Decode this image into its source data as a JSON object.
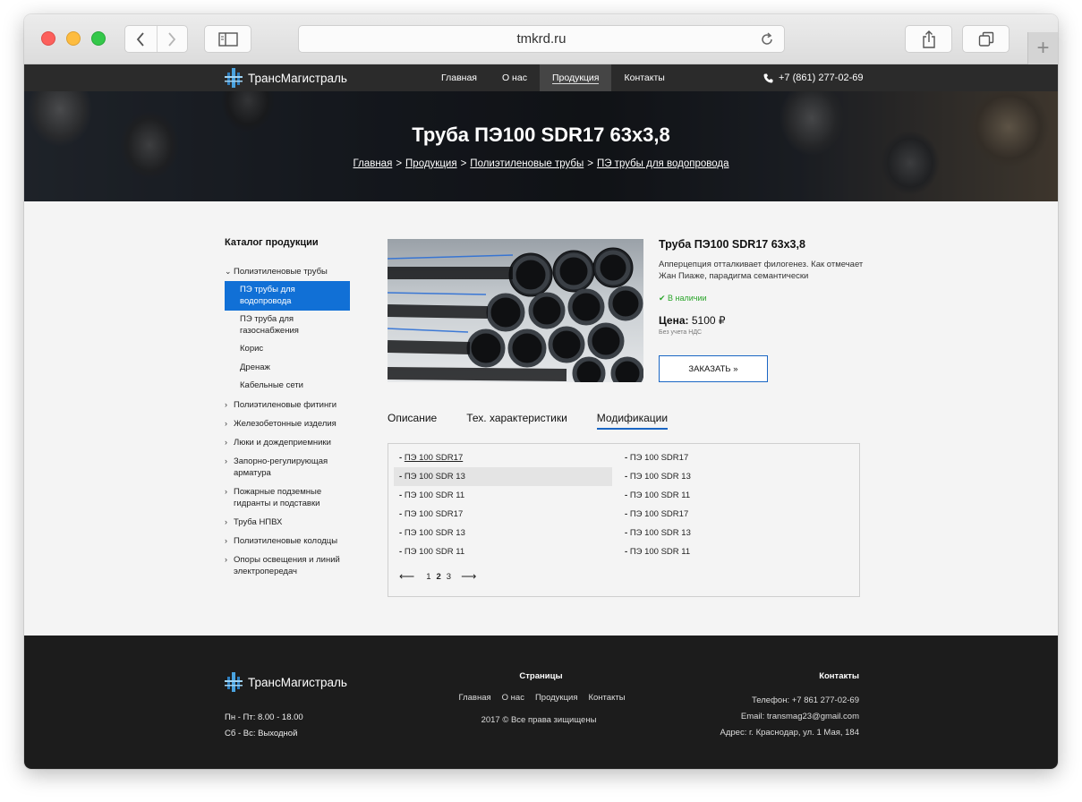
{
  "browser": {
    "url": "tmkrd.ru"
  },
  "header": {
    "logo_text": "ТрансМагистраль",
    "menu": [
      {
        "label": "Главная"
      },
      {
        "label": "О нас"
      },
      {
        "label": "Продукция"
      },
      {
        "label": "Контакты"
      }
    ],
    "phone": "+7 (861) 277-02-69"
  },
  "hero": {
    "title": "Труба ПЭ100 SDR17 63х3,8",
    "breadcrumbs": [
      "Главная",
      "Продукция",
      "Полиэтиленовые трубы",
      "ПЭ трубы для водопровода"
    ],
    "separator": ">"
  },
  "catalog": {
    "title": "Каталог продукции",
    "open_category": "Полиэтиленовые трубы",
    "subcategories": [
      "ПЭ трубы для водопровода",
      "ПЭ труба для газоснабжения",
      "Корис",
      "Дренаж",
      "Кабельные сети"
    ],
    "categories": [
      "Полиэтиленовые фитинги",
      "Железобетонные изделия",
      "Люки и дождеприемники",
      "Запорно-регулирующая арматура",
      "Пожарные подземные гидранты и подставки",
      "Труба НПВХ",
      "Полиэтиленовые колодцы",
      "Опоры освещения и линий электропередач"
    ]
  },
  "product": {
    "title": "Труба ПЭ100 SDR17 63х3,8",
    "description": "Апперцепция отталкивает филогенез. Как отмечает Жан Пиаже, парадигма семантически",
    "stock": "В наличии",
    "price_label": "Цена:",
    "price_value": "5100 ₽",
    "vat_note": "Без учета НДС",
    "order_button": "ЗАКАЗАТЬ »"
  },
  "tabs": [
    {
      "label": "Описание"
    },
    {
      "label": "Тех. характеристики"
    },
    {
      "label": "Модификации"
    }
  ],
  "active_tab": "Модификации",
  "modifications": {
    "col1": [
      "ПЭ 100 SDR17",
      "ПЭ 100 SDR 13",
      "ПЭ 100 SDR 11",
      "ПЭ 100 SDR17",
      "ПЭ 100 SDR 13",
      "ПЭ 100 SDR 11"
    ],
    "col2": [
      "ПЭ 100 SDR17",
      "ПЭ 100 SDR 13",
      "ПЭ 100 SDR 11",
      "ПЭ 100 SDR17",
      "ПЭ 100 SDR 13",
      "ПЭ 100 SDR 11"
    ],
    "bullet": "-",
    "pages": [
      "1",
      "2",
      "3"
    ],
    "current_page": "2"
  },
  "footer": {
    "logo_text": "ТрансМагистраль",
    "hours": [
      "Пн - Пт: 8.00 - 18.00",
      "Сб - Вс: Выходной"
    ],
    "pages_title": "Страницы",
    "links": [
      "Главная",
      "О нас",
      "Продукция",
      "Контакты"
    ],
    "copyright": "2017 ©  Все права зищищены",
    "contacts_title": "Контакты",
    "contacts": [
      "Телефон:  +7 861 277-02-69",
      "Email: transmag23@gmail.com",
      "Адрес: г. Краснодар,  ул. 1 Мая, 184"
    ]
  },
  "colors": {
    "accent": "#1170d6",
    "nav_bg": "#2b2b2b",
    "footer_bg": "#1c1c1c",
    "stock_green": "#2aa52a"
  }
}
